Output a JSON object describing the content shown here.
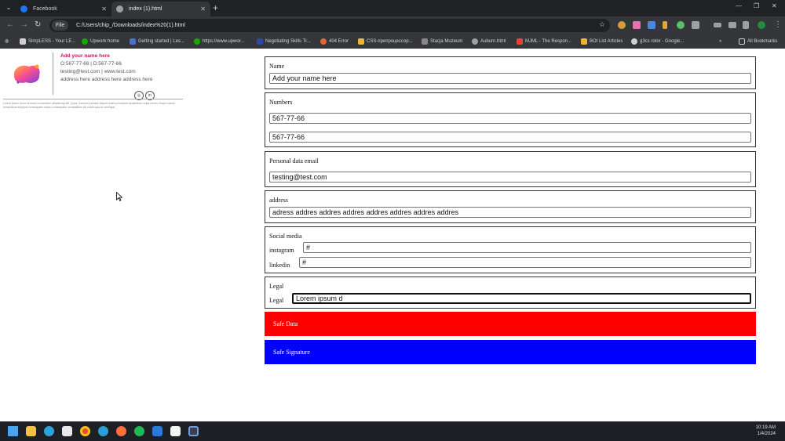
{
  "browser": {
    "tabs": [
      {
        "label": "Facebook"
      },
      {
        "label": "index (1).html"
      }
    ],
    "address": {
      "chip": "File",
      "url": "C:/Users/chip_/Downloads/index%20(1).html"
    },
    "bookmarks": [
      "SimpLESS - Your LE...",
      "Upwork home",
      "Getting started | Les...",
      "https://www.upwor...",
      "Negotiating Skills Tr...",
      "404 Error",
      "CSS-препроцессор...",
      "Stacja Muzeum",
      "Auburn.html",
      "MJML - The Respon...",
      "BOt List Articles",
      "g3cs rotor - Google..."
    ],
    "all_bookmarks": "All Bookmarks"
  },
  "signature": {
    "name": "Add your name here",
    "phones": "O:567-77-66 | D:567-77-66",
    "email_web": "testing@test.com | www.test.com",
    "address": "address here address here address here",
    "legal": "Lorem ipsum dolor sit amet consectetur adipisicing elit. Quas, dolorum pariatur aliquid autem provident laudantium culpa rerum, neque harum temporibus tempora consequatur totam consequatur voluptatibus illo nobis quia ex similique"
  },
  "form": {
    "name_section": {
      "label": "Name",
      "value": "Add your name here"
    },
    "numbers_section": {
      "label": "Numbers",
      "value1": "567-77-66",
      "value2": "567-77-66"
    },
    "email_section": {
      "label": "Personal data email",
      "value": "testing@test.com"
    },
    "address_section": {
      "label": "address",
      "value": "adress addres addres addres addres addres addres addres"
    },
    "social_section": {
      "label": "Social media",
      "instagram_label": "instagram",
      "instagram_value": "#",
      "linkedin_label": "linkedin",
      "linkedin_value": "#"
    },
    "legal_section": {
      "label": "Legal",
      "field_label": "Legal",
      "value": "Lorem ipsum d"
    },
    "save_data": "Safe Data",
    "save_signature": "Safe Signature"
  },
  "taskbar": {
    "time": "10:19 AM",
    "date": "1/4/2024"
  },
  "colors": {
    "save_data_bg": "#ff0000",
    "save_signature_bg": "#0000ff",
    "accent_name": "#c2185b"
  }
}
